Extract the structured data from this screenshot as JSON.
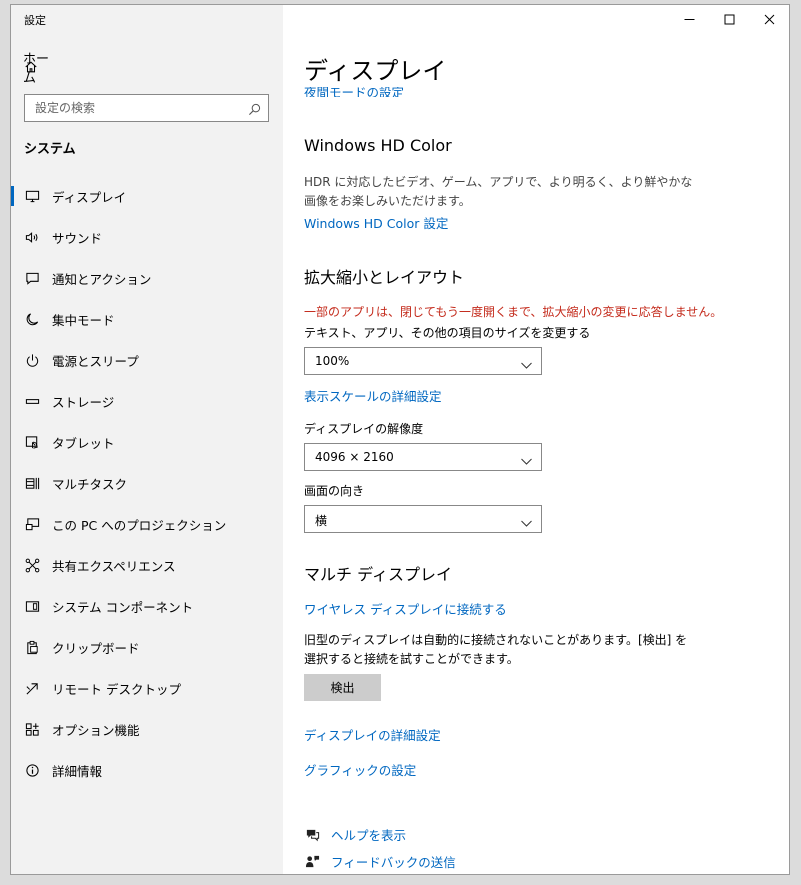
{
  "window": {
    "title": "設定"
  },
  "sidebar": {
    "home_label": "ホーム",
    "search_placeholder": "設定の検索",
    "section_heading": "システム",
    "items": [
      {
        "label": "ディスプレイ",
        "icon": "monitor-icon",
        "active": true
      },
      {
        "label": "サウンド",
        "icon": "speaker-icon"
      },
      {
        "label": "通知とアクション",
        "icon": "notification-icon"
      },
      {
        "label": "集中モード",
        "icon": "moon-icon"
      },
      {
        "label": "電源とスリープ",
        "icon": "power-icon"
      },
      {
        "label": "ストレージ",
        "icon": "storage-icon"
      },
      {
        "label": "タブレット",
        "icon": "tablet-icon"
      },
      {
        "label": "マルチタスク",
        "icon": "multitask-icon"
      },
      {
        "label": "この PC へのプロジェクション",
        "icon": "projection-icon"
      },
      {
        "label": "共有エクスペリエンス",
        "icon": "share-icon"
      },
      {
        "label": "システム コンポーネント",
        "icon": "components-icon"
      },
      {
        "label": "クリップボード",
        "icon": "clipboard-icon"
      },
      {
        "label": "リモート デスクトップ",
        "icon": "remote-desktop-icon"
      },
      {
        "label": "オプション機能",
        "icon": "optional-features-icon"
      },
      {
        "label": "詳細情報",
        "icon": "info-icon"
      }
    ]
  },
  "main": {
    "page_title": "ディスプレイ",
    "clipped_link": "夜間モードの設定",
    "hdr": {
      "heading": "Windows HD Color",
      "description": "HDR に対応したビデオ、ゲーム、アプリで、より明るく、より鮮やかな画像をお楽しみいただけます。",
      "link": "Windows HD Color 設定"
    },
    "scale": {
      "heading": "拡大縮小とレイアウト",
      "warning": "一部のアプリは、閉じてもう一度開くまで、拡大縮小の変更に応答しません。",
      "size_label": "テキスト、アプリ、その他の項目のサイズを変更する",
      "size_value": "100%",
      "advanced_link": "表示スケールの詳細設定",
      "resolution_label": "ディスプレイの解像度",
      "resolution_value": "4096 × 2160",
      "orientation_label": "画面の向き",
      "orientation_value": "横"
    },
    "multi": {
      "heading": "マルチ ディスプレイ",
      "wireless_link": "ワイヤレス ディスプレイに接続する",
      "description": "旧型のディスプレイは自動的に接続されないことがあります。[検出] を選択すると接続を試すことができます。",
      "detect_button": "検出",
      "advanced_link": "ディスプレイの詳細設定",
      "graphics_link": "グラフィックの設定"
    },
    "footer": {
      "help": "ヘルプを表示",
      "feedback": "フィードバックの送信"
    }
  },
  "colors": {
    "accent": "#0067c0",
    "warning": "#c42b1c",
    "sidebar_bg": "#f2f2f2"
  }
}
